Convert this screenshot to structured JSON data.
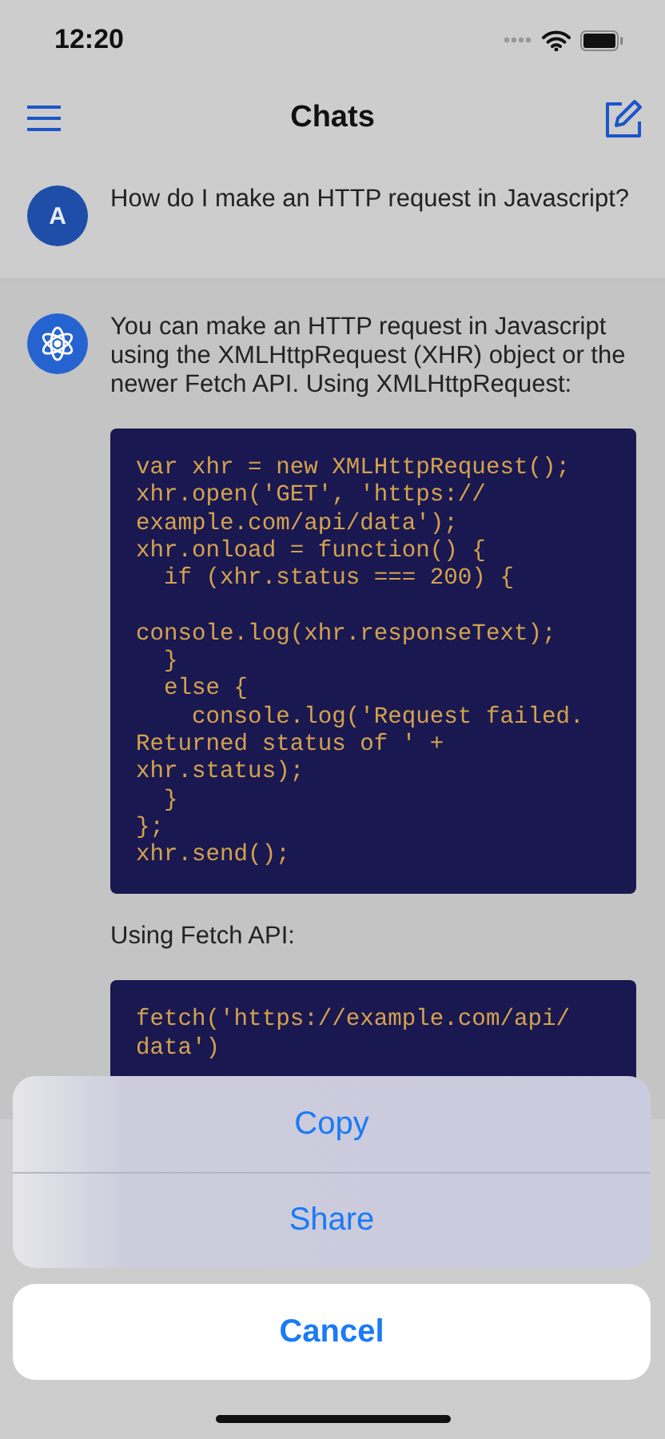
{
  "status_bar": {
    "time": "12:20"
  },
  "nav_bar": {
    "title": "Chats"
  },
  "messages": [
    {
      "kind": "user",
      "avatar": "A",
      "parts": [
        {
          "kind": "text",
          "text": "How do I make an HTTP request in Javascript?"
        }
      ]
    },
    {
      "kind": "assistant",
      "parts": [
        {
          "kind": "text",
          "text": "You can make an HTTP request in Javascript using the XMLHttpRequest (XHR) object or the newer Fetch API. Using XMLHttpRequest:"
        },
        {
          "kind": "code",
          "text": "var xhr = new XMLHttpRequest();\nxhr.open('GET', 'https://\nexample.com/api/data');\nxhr.onload = function() {\n  if (xhr.status === 200) {\n\nconsole.log(xhr.responseText);\n  }\n  else {\n    console.log('Request failed.\nReturned status of ' +\nxhr.status);\n  }\n};\nxhr.send();"
        },
        {
          "kind": "text",
          "text": "Using Fetch API:"
        },
        {
          "kind": "code",
          "text": "fetch('https://example.com/api/\ndata')"
        }
      ]
    }
  ],
  "action_sheet": {
    "actions": [
      "Copy",
      "Share"
    ],
    "cancel": "Cancel"
  }
}
